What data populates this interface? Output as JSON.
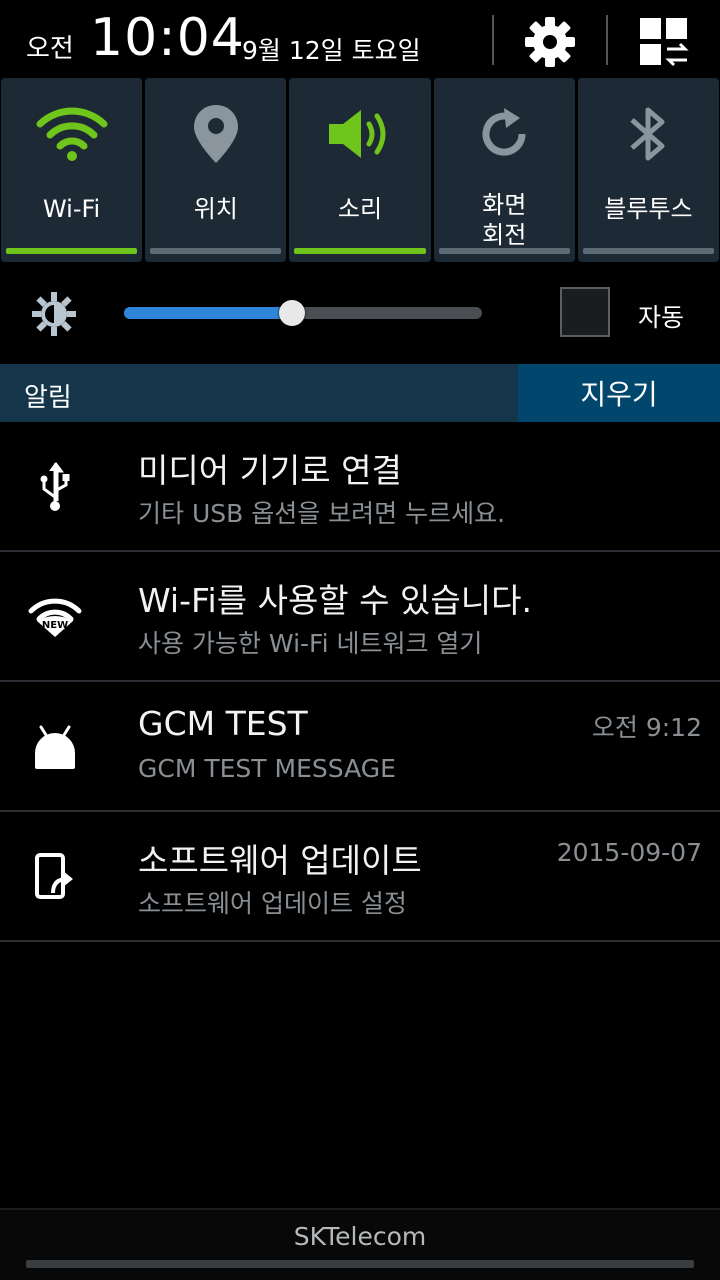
{
  "status": {
    "ampm": "오전",
    "time": "10:04",
    "date": "9월 12일 토요일"
  },
  "header_icons": {
    "settings": "gear-icon",
    "edit_toggles": "grid-swap-icon"
  },
  "quick_toggles": [
    {
      "label": "Wi-Fi",
      "icon": "wifi-icon",
      "on": true
    },
    {
      "label": "위치",
      "icon": "location-pin-icon",
      "on": false
    },
    {
      "label": "소리",
      "icon": "speaker-icon",
      "on": true
    },
    {
      "label_line1": "화면",
      "label_line2": "회전",
      "icon": "rotate-icon",
      "on": false
    },
    {
      "label": "블루투스",
      "icon": "bluetooth-icon",
      "on": false
    }
  ],
  "brightness": {
    "level_fraction": 0.47,
    "auto_label": "자동",
    "auto_checked": false
  },
  "notifications_bar": {
    "title": "알림",
    "clear_label": "지우기"
  },
  "notifications": [
    {
      "icon": "usb-icon",
      "title": "미디어 기기로 연결",
      "subtitle": "기타 USB 옵션을 보려면 누르세요.",
      "time": ""
    },
    {
      "icon": "wifi-new-icon",
      "title": "Wi-Fi를 사용할 수 있습니다.",
      "subtitle": "사용 가능한 Wi-Fi 네트워크 열기",
      "time": ""
    },
    {
      "icon": "android-icon",
      "title": "GCM TEST",
      "subtitle": "GCM TEST MESSAGE",
      "time": "오전 9:12"
    },
    {
      "icon": "software-update-icon",
      "title": "소프트웨어 업데이트",
      "subtitle": "소프트웨어 업데이트 설정",
      "time": "2015-09-07"
    }
  ],
  "footer": {
    "carrier": "SKTelecom"
  },
  "colors": {
    "accent_green": "#6fc51c",
    "accent_blue": "#2f86d8",
    "toggle_bg": "#1d2a35",
    "notif_bar_bg": "#14354a",
    "clear_bg": "#01476d"
  }
}
